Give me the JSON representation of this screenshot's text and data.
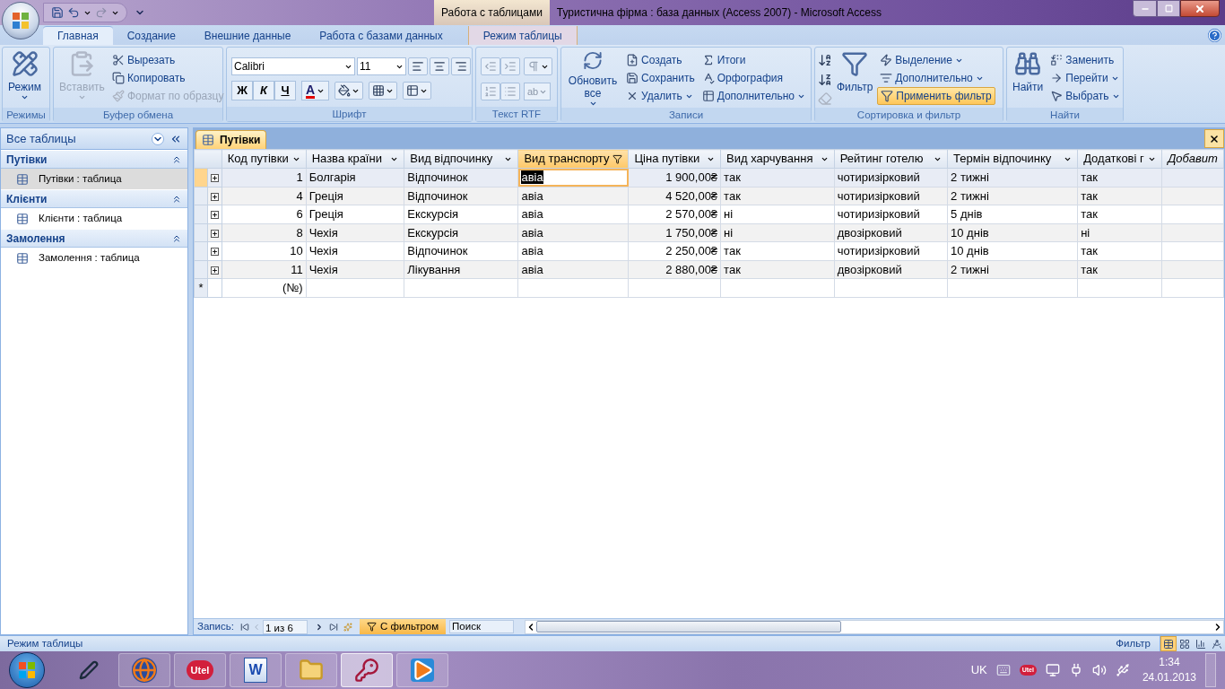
{
  "window": {
    "context_label": "Работа с таблицами",
    "title": "Туристична фірма : база данных (Access 2007)  -  Microsoft Access"
  },
  "ribbon_tabs": [
    {
      "label": "Главная",
      "selected": true,
      "contextual": false
    },
    {
      "label": "Создание",
      "selected": false,
      "contextual": false
    },
    {
      "label": "Внешние данные",
      "selected": false,
      "contextual": false
    },
    {
      "label": "Работа с базами данных",
      "selected": false,
      "contextual": false
    },
    {
      "label": "Режим таблицы",
      "selected": false,
      "contextual": true
    }
  ],
  "ribbon_groups": [
    {
      "kind": "views",
      "label": "Режимы",
      "large": {
        "label": "Режим",
        "disabled": false,
        "menu": true
      }
    },
    {
      "kind": "clipboard",
      "label": "Буфер обмена",
      "large": {
        "label": "Вставить",
        "disabled": true,
        "menu": true
      },
      "small": [
        {
          "label": "Вырезать",
          "disabled": false,
          "menu": false,
          "on": false
        },
        {
          "label": "Копировать",
          "disabled": false,
          "menu": false,
          "on": false
        },
        {
          "label": "Формат по образцу",
          "disabled": true,
          "menu": false,
          "on": false
        }
      ]
    },
    {
      "kind": "font",
      "label": "Шрифт",
      "font": "Calibri",
      "size": "11",
      "format_buttons": [
        "Ж",
        "К",
        "Ч"
      ],
      "color_letter": "A"
    },
    {
      "kind": "rtf",
      "label": "Текст RTF",
      "highlight_text": "ab"
    },
    {
      "kind": "records",
      "label": "Записи",
      "large": {
        "label": "Обновить все",
        "disabled": false,
        "menu": true
      },
      "small": [
        {
          "label": "Создать",
          "disabled": false,
          "menu": false,
          "on": false
        },
        {
          "label": "Сохранить",
          "disabled": false,
          "menu": false,
          "on": false
        },
        {
          "label": "Удалить",
          "disabled": false,
          "menu": true,
          "on": false
        },
        {
          "label": "Итоги",
          "disabled": false,
          "menu": false,
          "on": false
        },
        {
          "label": "Орфография",
          "disabled": false,
          "menu": false,
          "on": false
        },
        {
          "label": "Дополнительно",
          "disabled": false,
          "menu": true,
          "on": false
        }
      ]
    },
    {
      "kind": "sort",
      "label": "Сортировка и фильтр",
      "large": {
        "label": "Фильтр",
        "disabled": false,
        "menu": false
      },
      "small": [
        {
          "label": "Выделение",
          "disabled": false,
          "menu": true,
          "on": false
        },
        {
          "label": "Дополнительно",
          "disabled": false,
          "menu": true,
          "on": false
        },
        {
          "label": "Применить фильтр",
          "disabled": false,
          "menu": false,
          "on": true
        }
      ]
    },
    {
      "kind": "find",
      "label": "Найти",
      "large": {
        "label": "Найти",
        "disabled": false,
        "menu": false
      },
      "small": [
        {
          "label": "Заменить",
          "disabled": false,
          "menu": false,
          "on": false
        },
        {
          "label": "Перейти",
          "disabled": false,
          "menu": true,
          "on": false
        },
        {
          "label": "Выбрать",
          "disabled": false,
          "menu": true,
          "on": false
        }
      ]
    }
  ],
  "nav_pane": {
    "title": "Все таблицы",
    "groups": [
      {
        "label": "Путівки",
        "items": [
          {
            "label": "Путівки : таблица",
            "selected": true
          }
        ]
      },
      {
        "label": "Клієнти",
        "items": [
          {
            "label": "Клієнти : таблица",
            "selected": false
          }
        ]
      },
      {
        "label": "Замолення",
        "items": [
          {
            "label": "Замолення : таблица",
            "selected": false
          }
        ]
      }
    ]
  },
  "document_tab": {
    "label": "Путівки"
  },
  "table": {
    "columns": [
      {
        "label": "Код путівки",
        "kind": "number",
        "filtered": false,
        "selected": false
      },
      {
        "label": "Назва країни",
        "kind": "text",
        "filtered": false,
        "selected": false
      },
      {
        "label": "Вид відпочинку",
        "kind": "text",
        "filtered": false,
        "selected": false
      },
      {
        "label": "Вид транспорту",
        "kind": "text",
        "filtered": true,
        "selected": true
      },
      {
        "label": "Ціна путівки",
        "kind": "number",
        "filtered": false,
        "selected": false
      },
      {
        "label": "Вид харчування",
        "kind": "text",
        "filtered": false,
        "selected": false
      },
      {
        "label": "Рейтинг готелю",
        "kind": "text",
        "filtered": false,
        "selected": false
      },
      {
        "label": "Термін відпочинку",
        "kind": "text",
        "filtered": false,
        "selected": false
      },
      {
        "label": "Додаткові г",
        "kind": "text",
        "filtered": false,
        "selected": false
      },
      {
        "label": "Добавит",
        "kind": "new",
        "filtered": false,
        "selected": false
      }
    ],
    "rows": [
      {
        "selected": true,
        "cells": [
          "1",
          "Болгарія",
          "Відпочинок",
          "авіа",
          "1 900,00₴",
          "так",
          "чотиризірковий",
          "2 тижні",
          "так"
        ]
      },
      {
        "selected": false,
        "cells": [
          "4",
          "Греція",
          "Відпочинок",
          "авіа",
          "4 520,00₴",
          "так",
          "чотиризірковий",
          "2 тижні",
          "так"
        ]
      },
      {
        "selected": false,
        "cells": [
          "6",
          "Греція",
          "Екскурсія",
          "авіа",
          "2 570,00₴",
          "ні",
          "чотиризірковий",
          "5 днів",
          "так"
        ]
      },
      {
        "selected": false,
        "cells": [
          "8",
          "Чехія",
          "Екскурсія",
          "авіа",
          "1 750,00₴",
          "ні",
          "двозірковий",
          "10 днів",
          "ні"
        ]
      },
      {
        "selected": false,
        "cells": [
          "10",
          "Чехія",
          "Відпочинок",
          "авіа",
          "2 250,00₴",
          "так",
          "чотиризірковий",
          "10 днів",
          "так"
        ]
      },
      {
        "selected": false,
        "cells": [
          "11",
          "Чехія",
          "Лікування",
          "авіа",
          "2 880,00₴",
          "так",
          "двозірковий",
          "2 тижні",
          "так"
        ]
      }
    ],
    "new_row": {
      "marker": "*",
      "code": "(№)"
    }
  },
  "record_nav": {
    "label": "Запись:",
    "position": "1 из 6",
    "filter": {
      "label": "С фильтром",
      "on": true
    },
    "search_placeholder": "Поиск"
  },
  "status_bar": {
    "mode": "Режим таблицы",
    "filter": "Фильтр",
    "views": [
      {
        "selected": true
      },
      {
        "selected": false
      },
      {
        "selected": false
      },
      {
        "selected": false
      }
    ]
  },
  "taskbar": {
    "apps": [
      {
        "kind": "pen",
        "active": false
      },
      {
        "kind": "firefox",
        "active": false
      },
      {
        "kind": "utel",
        "label": "Utel",
        "active": false
      },
      {
        "kind": "word",
        "label": "W",
        "active": false
      },
      {
        "kind": "explorer",
        "active": false
      },
      {
        "kind": "access",
        "active": true
      },
      {
        "kind": "media",
        "active": false
      }
    ],
    "language": "UK",
    "tray_badge": "Utel",
    "time": "1:34",
    "date": "24.01.2013"
  }
}
